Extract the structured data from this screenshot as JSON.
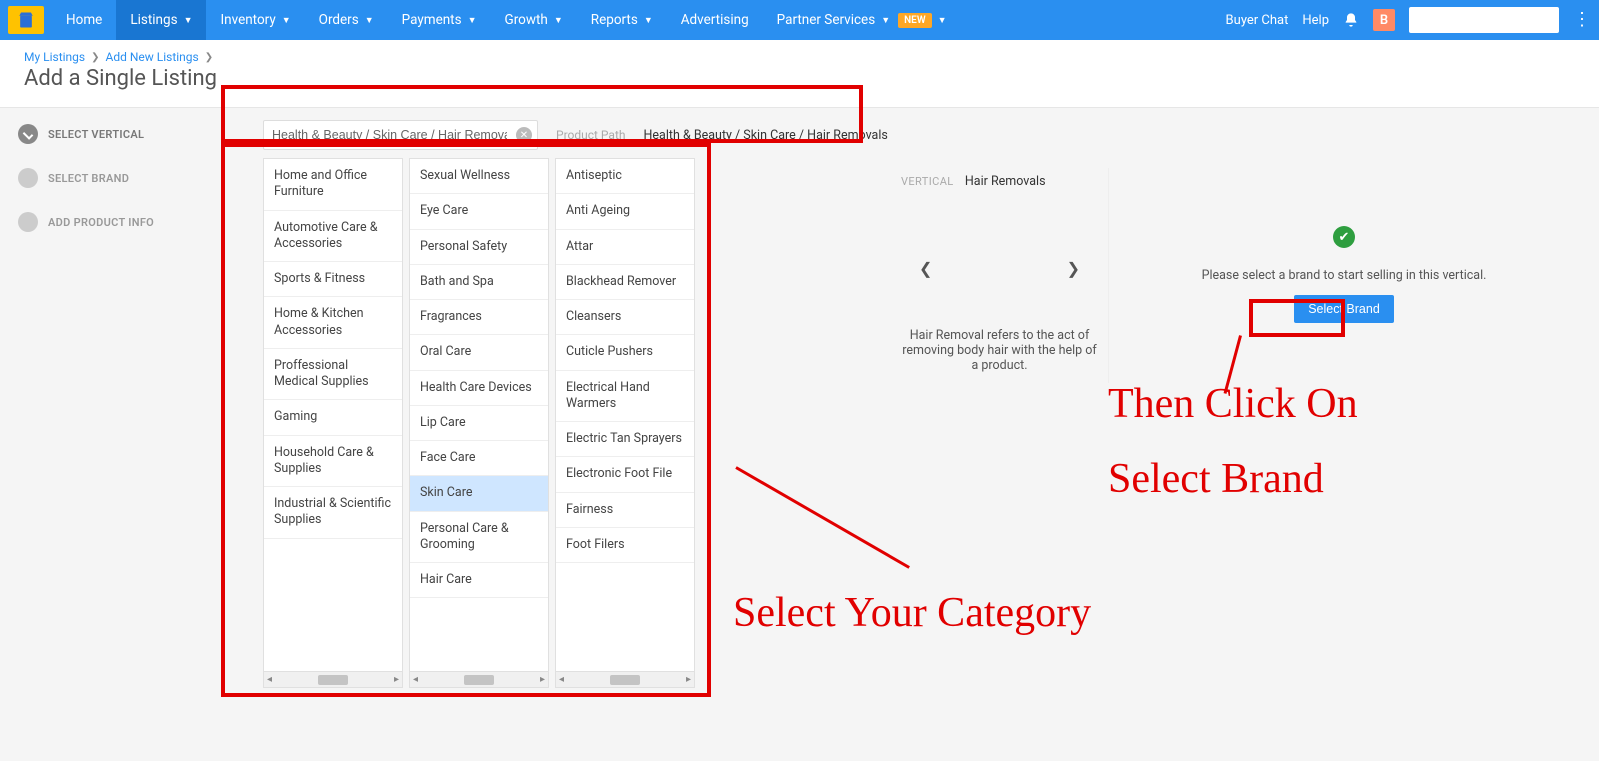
{
  "nav": {
    "items": [
      "Home",
      "Listings",
      "Inventory",
      "Orders",
      "Payments",
      "Growth",
      "Reports",
      "Advertising",
      "Partner Services"
    ],
    "dropdown": [
      false,
      true,
      true,
      true,
      true,
      true,
      true,
      false,
      true
    ],
    "active_idx": 1,
    "new_badge": "NEW",
    "right": {
      "buyer_chat": "Buyer Chat",
      "help": "Help",
      "user_initial": "B"
    }
  },
  "breadcrumb": {
    "a": "My Listings",
    "b": "Add New Listings"
  },
  "page_title": "Add a Single Listing",
  "steps": {
    "s1": "SELECT VERTICAL",
    "s2": "SELECT BRAND",
    "s3": "ADD PRODUCT INFO"
  },
  "search": {
    "value": "Health & Beauty / Skin Care / Hair Removals"
  },
  "product_path": {
    "label": "Product Path",
    "value": "Health & Beauty / Skin Care / Hair Removals"
  },
  "col1": [
    "Home and Office Furniture",
    "Automotive Care & Accessories",
    "Sports & Fitness",
    "Home & Kitchen Accessories",
    "Proffessional Medical Supplies",
    "Gaming",
    "Household Care & Supplies",
    "Industrial & Scientific Supplies"
  ],
  "col2": [
    "Sexual Wellness",
    "Eye Care",
    "Personal Safety",
    "Bath and Spa",
    "Fragrances",
    "Oral Care",
    "Health Care Devices",
    "Lip Care",
    "Face Care",
    "Skin Care",
    "Personal Care & Grooming",
    "Hair Care"
  ],
  "col2_selected_idx": 9,
  "col3": [
    "Antiseptic",
    "Anti Ageing",
    "Attar",
    "Blackhead Remover",
    "Cleansers",
    "Cuticle Pushers",
    "Electrical Hand Warmers",
    "Electric Tan Sprayers",
    "Electronic Foot File",
    "Fairness",
    "Foot Filers"
  ],
  "detail": {
    "vertical_label": "VERTICAL",
    "vertical_value": "Hair Removals",
    "desc": "Hair Removal refers to the act of removing body hair with the help of a product.",
    "brand_msg": "Please select a brand to start selling in this vertical.",
    "select_brand_btn": "Select Brand"
  },
  "annotations": {
    "a1": "Select Your Category",
    "a2_l1": "Then Click On",
    "a2_l2": "Select Brand"
  }
}
